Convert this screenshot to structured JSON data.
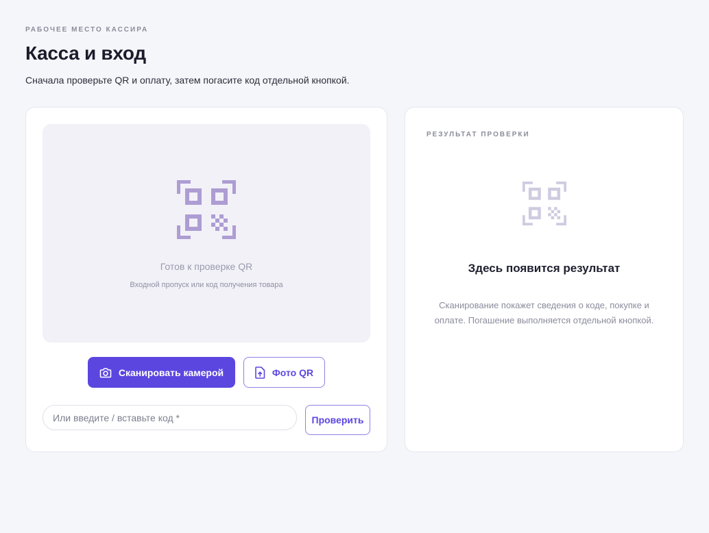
{
  "header": {
    "eyebrow": "РАБОЧЕЕ МЕСТО КАССИРА",
    "title": "Касса и вход",
    "subtitle": "Сначала проверьте QR и оплату, затем погасите код отдельной кнопкой."
  },
  "scanner": {
    "status_title": "Готов к проверке QR",
    "status_hint": "Входной пропуск или код получения товара",
    "qr_icon": "qr-code-icon"
  },
  "actions": {
    "scan_camera_label": "Сканировать камерой",
    "scan_camera_icon": "camera-icon",
    "photo_qr_label": "Фото QR",
    "photo_qr_icon": "file-upload-icon",
    "code_placeholder": "Или введите / вставьте код *",
    "code_value": "",
    "check_label": "Проверить"
  },
  "result": {
    "label": "РЕЗУЛЬТАТ ПРОВЕРКИ",
    "title": "Здесь появится результат",
    "text": "Сканирование покажет сведения о коде, покупке и оплате. Погашение выполняется отдельной кнопкой.",
    "qr_icon": "qr-code-icon"
  },
  "colors": {
    "accent": "#5b46e0",
    "qr_active": "#ad9dd3",
    "qr_muted": "#cfcbe0",
    "background": "#f5f6fa"
  }
}
